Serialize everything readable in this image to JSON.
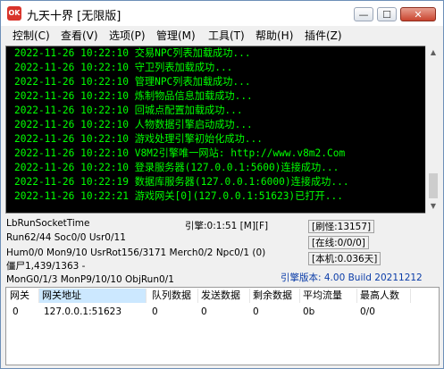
{
  "window": {
    "title": "九天十界 [无限版]",
    "icon": "app-logo-icon",
    "icon_text": "OK",
    "min_glyph": "—",
    "max_glyph": "☐",
    "close_glyph": "✕"
  },
  "menu": [
    "控制(C)",
    "查看(V)",
    "选项(P)",
    "管理(M)",
    "工具(T)",
    "帮助(H)",
    "插件(Z)"
  ],
  "log": [
    "2022-11-26 10:22:10 交易NPC列表加载成功...",
    "2022-11-26 10:22:10 守卫列表加载成功...",
    "2022-11-26 10:22:10 管理NPC列表加载成功...",
    "2022-11-26 10:22:10 炼制物品信息加载成功...",
    "2022-11-26 10:22:10 回城点配置加载成功...",
    "2022-11-26 10:22:10 人物数据引擎启动成功...",
    "2022-11-26 10:22:10 游戏处理引擎初始化成功...",
    "2022-11-26 10:22:10 V8M2引擎唯一网站: http://www.v8m2.Com",
    "2022-11-26 10:22:10 登录服务器(127.0.0.1:5600)连接成功...",
    "2022-11-26 10:22:19 数据库服务器(127.0.0.1:6000)连接成功...",
    "2022-11-26 10:22:21 游戏网关[0](127.0.0.1:51623)已打开..."
  ],
  "status": {
    "line1": "LbRunSocketTime",
    "line2": "Run62/44 Soc0/0 Usr0/11",
    "line3": "Hum0/0 Mon9/10 UsrRot156/3171 Merch0/2 Npc0/1 (0)",
    "line4": "僵尸1,439/1363 -",
    "line5": "MonG0/1/3 MonP9/10/10 ObjRun0/1",
    "engine_time": "引擎:0:1:51 [M][F]",
    "refresh": "[刷怪:13157]",
    "online": "[在线:0/0/0]",
    "local": "[本机:0.036天]",
    "engine_version": "引擎版本: 4.00 Build 20211212"
  },
  "gateway_table": {
    "headers": [
      "网关",
      "网关地址",
      "队列数据",
      "发送数据",
      "剩余数据",
      "平均流量",
      "最高人数"
    ],
    "rows": [
      [
        "0",
        "127.0.0.1:51623",
        "0",
        "0",
        "0",
        "0b",
        "0/0"
      ]
    ]
  },
  "colors": {
    "console_bg": "#000000",
    "console_text": "#00ff00",
    "version_text": "#0a3ca8",
    "selected_header": "#cce8ff"
  }
}
